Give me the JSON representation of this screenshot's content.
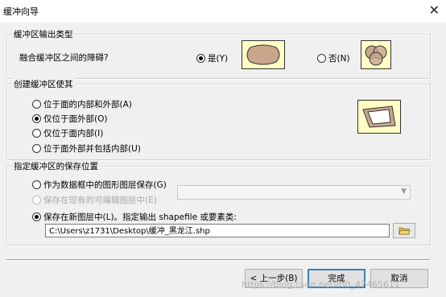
{
  "window": {
    "title": "缓冲向导",
    "close_glyph": "✕"
  },
  "output_type": {
    "legend": "缓冲区输出类型",
    "question": "融合缓冲区之间的障碍?",
    "options": [
      {
        "label": "是(Y)",
        "checked": true
      },
      {
        "label": "否(N)",
        "checked": false
      }
    ],
    "illustration_bg": "#ffffc6"
  },
  "buffer_side": {
    "legend": "创建缓冲区使其",
    "options": [
      {
        "label": "位于面的内部和外部(A)",
        "checked": false
      },
      {
        "label": "仅位于面外部(O)",
        "checked": true
      },
      {
        "label": "仅位于面内部(I)",
        "checked": false
      },
      {
        "label": "位于面外部并包括内部(U)",
        "checked": false
      }
    ]
  },
  "save_location": {
    "legend": "指定缓冲区的保存位置",
    "options": [
      {
        "label": "作为数据框中的图形图层保存(G)",
        "checked": false,
        "disabled": false
      },
      {
        "label": "保存在现有的可编辑图层中(E)",
        "checked": false,
        "disabled": true
      },
      {
        "label": "保存在新图层中(L)。指定输出 shapefile 或要素类:",
        "checked": true,
        "disabled": false
      }
    ],
    "dropdown_value": "",
    "output_path": "C:\\Users\\z1731\\Desktop\\缓冲_黑龙江.shp",
    "folder_icon": "folder-open-icon"
  },
  "buttons": {
    "back": "< 上一步(B)",
    "finish": "完成",
    "cancel": "取消"
  },
  "watermark": "https://blog.csdn.net/m0_47465611"
}
